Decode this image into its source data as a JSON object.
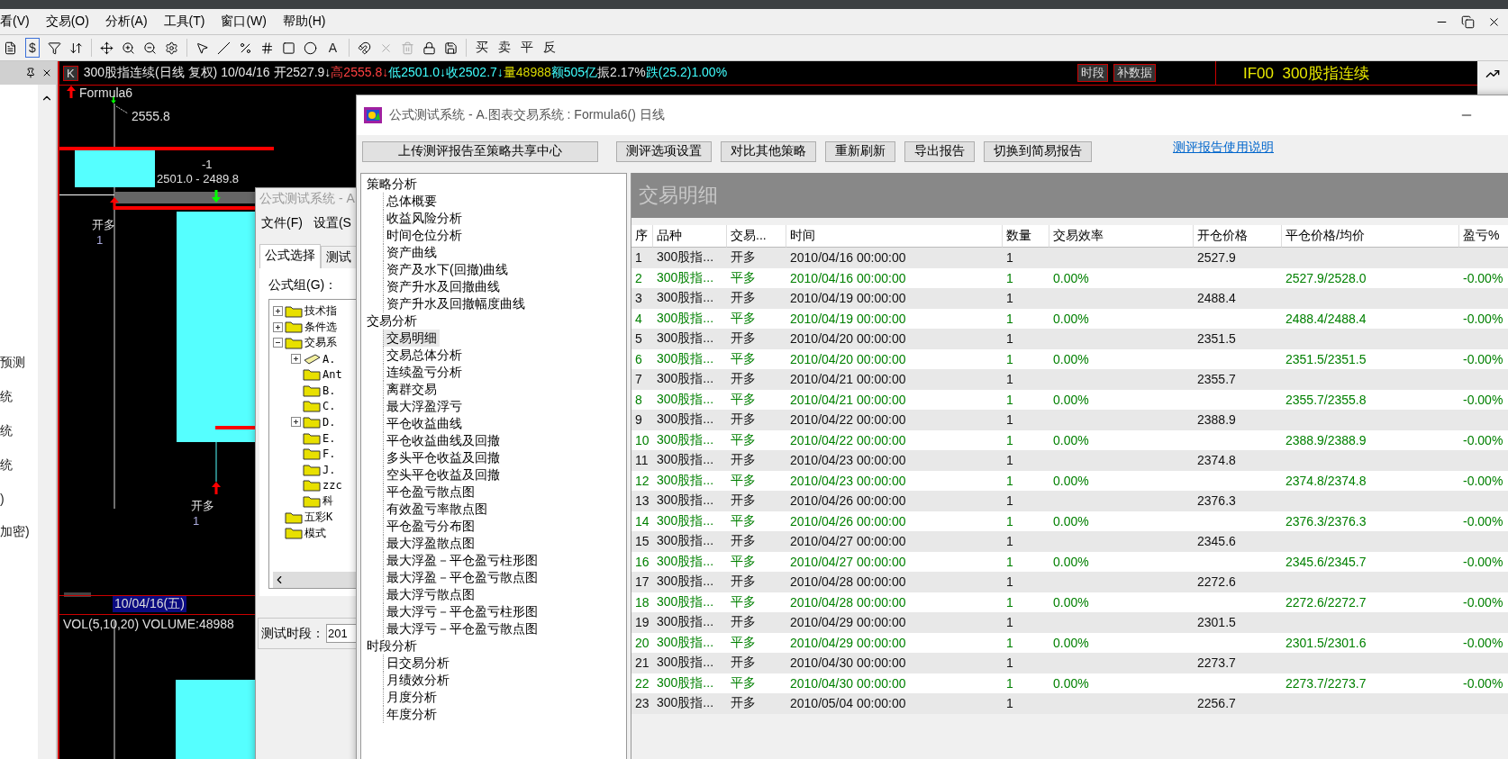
{
  "menu": [
    "看(V)",
    "交易(O)",
    "分析(A)",
    "工具(T)",
    "窗口(W)",
    "帮助(H)"
  ],
  "toolbar": {
    "currency": "$",
    "text_tool": "A",
    "trade": [
      "买",
      "卖",
      "平",
      "反"
    ]
  },
  "side_panel": {
    "items": [
      "预测",
      "统",
      "统",
      "统",
      ")",
      "加密)"
    ]
  },
  "chart": {
    "mode": "K",
    "segments": [
      {
        "text": "300股指连续(日线 复权) 10/04/16 开2527.9↓",
        "color": "#e8e8e8"
      },
      {
        "text": "高2555.8↓",
        "color": "#ff4040"
      },
      {
        "text": "低2501.0↓收2502.7↓",
        "color": "#40ffff"
      },
      {
        "text": "量48988",
        "color": "#d8d800"
      },
      {
        "text": "额505亿",
        "color": "#40ffff"
      },
      {
        "text": "振2.17%",
        "color": "#e8e8e8"
      },
      {
        "text": "跌(25.2)1.00%",
        "color": "#40ffff"
      }
    ],
    "buttons": [
      "时段",
      "补数据"
    ],
    "formula": "Formula6",
    "high_label": "2555.8",
    "minus_label": "-1",
    "range_label": "2501.0 - 2489.8",
    "signals": [
      {
        "text": "开多",
        "qty": "1"
      },
      {
        "text": "开多",
        "qty": "1"
      }
    ],
    "date": "10/04/16(五)",
    "volume": "VOL(5,10,20) VOLUME:48988",
    "symbol": "IF00  300股指连续"
  },
  "back_dialog": {
    "title": "公式测试系统 - A",
    "menu": [
      "文件(F)",
      "设置(S"
    ],
    "tabs": [
      {
        "label": "公式选择",
        "selected": true
      },
      {
        "label": "测试",
        "selected": false
      }
    ],
    "group_label": "公式组(G)：",
    "tree": [
      {
        "label": "技术指",
        "expanded": false
      },
      {
        "label": "条件选",
        "expanded": false
      },
      {
        "label": "交易系",
        "expanded": true,
        "children": [
          {
            "label": "A.",
            "expanded": false,
            "kind": "system"
          },
          {
            "label": "Ant"
          },
          {
            "label": "B."
          },
          {
            "label": "C."
          },
          {
            "label": "D.",
            "expanded": false
          },
          {
            "label": "E."
          },
          {
            "label": "F."
          },
          {
            "label": "J."
          },
          {
            "label": "zzc"
          },
          {
            "label": "科"
          }
        ]
      },
      {
        "label": "五彩K"
      },
      {
        "label": "模式"
      }
    ],
    "period_label": "测试时段：",
    "period_value": "201"
  },
  "dialog": {
    "title": "公式测试系统 - A.图表交易系统 : Formula6() 日线",
    "buttons": [
      "上传测评报告至策略共享中心",
      "测评选项设置",
      "对比其他策略",
      "重新刷新",
      "导出报告",
      "切换到简易报告"
    ],
    "help_link": "测评报告使用说明",
    "nav": [
      {
        "label": "策略分析",
        "children": [
          {
            "label": "总体概要",
            "selected": false
          },
          {
            "label": "收益风险分析",
            "selected": false
          },
          {
            "label": "时间仓位分析",
            "selected": false
          },
          {
            "label": "资产曲线",
            "selected": false
          },
          {
            "label": "资产及水下(回撤)曲线",
            "selected": false
          },
          {
            "label": "资产升水及回撤曲线",
            "selected": false
          },
          {
            "label": "资产升水及回撤幅度曲线",
            "selected": false
          }
        ]
      },
      {
        "label": "交易分析",
        "children": [
          {
            "label": "交易明细",
            "selected": true
          },
          {
            "label": "交易总体分析",
            "selected": false
          },
          {
            "label": "连续盈亏分析",
            "selected": false
          },
          {
            "label": "离群交易",
            "selected": false
          },
          {
            "label": "最大浮盈浮亏",
            "selected": false
          },
          {
            "label": "平仓收益曲线",
            "selected": false
          },
          {
            "label": "平仓收益曲线及回撤",
            "selected": false
          },
          {
            "label": "多头平仓收益及回撤",
            "selected": false
          },
          {
            "label": "空头平仓收益及回撤",
            "selected": false
          },
          {
            "label": "平仓盈亏散点图",
            "selected": false
          },
          {
            "label": "有效盈亏率散点图",
            "selected": false
          },
          {
            "label": "平仓盈亏分布图",
            "selected": false
          },
          {
            "label": "最大浮盈散点图",
            "selected": false
          },
          {
            "label": "最大浮盈－平仓盈亏柱形图",
            "selected": false
          },
          {
            "label": "最大浮盈－平仓盈亏散点图",
            "selected": false
          },
          {
            "label": "最大浮亏散点图",
            "selected": false
          },
          {
            "label": "最大浮亏－平仓盈亏柱形图",
            "selected": false
          },
          {
            "label": "最大浮亏－平仓盈亏散点图",
            "selected": false
          }
        ]
      },
      {
        "label": "时段分析",
        "children": [
          {
            "label": "日交易分析",
            "selected": false
          },
          {
            "label": "月绩效分析",
            "selected": false
          },
          {
            "label": "月度分析",
            "selected": false
          },
          {
            "label": "年度分析",
            "selected": false
          }
        ]
      }
    ],
    "panel_title": "交易明细",
    "columns": [
      "序",
      "品种",
      "交易...",
      "时间",
      "数量",
      "交易效率",
      "开仓价格",
      "平仓价格/均价",
      "盈亏%"
    ],
    "rows": [
      {
        "kind": "open",
        "cells": [
          "1",
          "300股指...",
          "开多",
          "2010/04/16 00:00:00",
          "1",
          "",
          "2527.9",
          "",
          ""
        ]
      },
      {
        "kind": "close",
        "cells": [
          "2",
          "300股指...",
          "平多",
          "2010/04/16 00:00:00",
          "1",
          "0.00%",
          "",
          "2527.9/2528.0",
          "-0.00%"
        ]
      },
      {
        "kind": "open",
        "cells": [
          "3",
          "300股指...",
          "开多",
          "2010/04/19 00:00:00",
          "1",
          "",
          "2488.4",
          "",
          ""
        ]
      },
      {
        "kind": "close",
        "cells": [
          "4",
          "300股指...",
          "平多",
          "2010/04/19 00:00:00",
          "1",
          "0.00%",
          "",
          "2488.4/2488.4",
          "-0.00%"
        ]
      },
      {
        "kind": "open",
        "cells": [
          "5",
          "300股指...",
          "开多",
          "2010/04/20 00:00:00",
          "1",
          "",
          "2351.5",
          "",
          ""
        ]
      },
      {
        "kind": "close",
        "cells": [
          "6",
          "300股指...",
          "平多",
          "2010/04/20 00:00:00",
          "1",
          "0.00%",
          "",
          "2351.5/2351.5",
          "-0.00%"
        ]
      },
      {
        "kind": "open",
        "cells": [
          "7",
          "300股指...",
          "开多",
          "2010/04/21 00:00:00",
          "1",
          "",
          "2355.7",
          "",
          ""
        ]
      },
      {
        "kind": "close",
        "cells": [
          "8",
          "300股指...",
          "平多",
          "2010/04/21 00:00:00",
          "1",
          "0.00%",
          "",
          "2355.7/2355.8",
          "-0.00%"
        ]
      },
      {
        "kind": "open",
        "cells": [
          "9",
          "300股指...",
          "开多",
          "2010/04/22 00:00:00",
          "1",
          "",
          "2388.9",
          "",
          ""
        ]
      },
      {
        "kind": "close",
        "cells": [
          "10",
          "300股指...",
          "平多",
          "2010/04/22 00:00:00",
          "1",
          "0.00%",
          "",
          "2388.9/2388.9",
          "-0.00%"
        ]
      },
      {
        "kind": "open",
        "cells": [
          "11",
          "300股指...",
          "开多",
          "2010/04/23 00:00:00",
          "1",
          "",
          "2374.8",
          "",
          ""
        ]
      },
      {
        "kind": "close",
        "cells": [
          "12",
          "300股指...",
          "平多",
          "2010/04/23 00:00:00",
          "1",
          "0.00%",
          "",
          "2374.8/2374.8",
          "-0.00%"
        ]
      },
      {
        "kind": "open",
        "cells": [
          "13",
          "300股指...",
          "开多",
          "2010/04/26 00:00:00",
          "1",
          "",
          "2376.3",
          "",
          ""
        ]
      },
      {
        "kind": "close",
        "cells": [
          "14",
          "300股指...",
          "平多",
          "2010/04/26 00:00:00",
          "1",
          "0.00%",
          "",
          "2376.3/2376.3",
          "-0.00%"
        ]
      },
      {
        "kind": "open",
        "cells": [
          "15",
          "300股指...",
          "开多",
          "2010/04/27 00:00:00",
          "1",
          "",
          "2345.6",
          "",
          ""
        ]
      },
      {
        "kind": "close",
        "cells": [
          "16",
          "300股指...",
          "平多",
          "2010/04/27 00:00:00",
          "1",
          "0.00%",
          "",
          "2345.6/2345.7",
          "-0.00%"
        ]
      },
      {
        "kind": "open",
        "cells": [
          "17",
          "300股指...",
          "开多",
          "2010/04/28 00:00:00",
          "1",
          "",
          "2272.6",
          "",
          ""
        ]
      },
      {
        "kind": "close",
        "cells": [
          "18",
          "300股指...",
          "平多",
          "2010/04/28 00:00:00",
          "1",
          "0.00%",
          "",
          "2272.6/2272.7",
          "-0.00%"
        ]
      },
      {
        "kind": "open",
        "cells": [
          "19",
          "300股指...",
          "开多",
          "2010/04/29 00:00:00",
          "1",
          "",
          "2301.5",
          "",
          ""
        ]
      },
      {
        "kind": "close",
        "cells": [
          "20",
          "300股指...",
          "平多",
          "2010/04/29 00:00:00",
          "1",
          "0.00%",
          "",
          "2301.5/2301.6",
          "-0.00%"
        ]
      },
      {
        "kind": "open",
        "cells": [
          "21",
          "300股指...",
          "开多",
          "2010/04/30 00:00:00",
          "1",
          "",
          "2273.7",
          "",
          ""
        ]
      },
      {
        "kind": "close",
        "cells": [
          "22",
          "300股指...",
          "平多",
          "2010/04/30 00:00:00",
          "1",
          "0.00%",
          "",
          "2273.7/2273.7",
          "-0.00%"
        ]
      },
      {
        "kind": "open",
        "cells": [
          "23",
          "300股指...",
          "开多",
          "2010/05/04 00:00:00",
          "1",
          "",
          "2256.7",
          "",
          ""
        ]
      }
    ]
  }
}
